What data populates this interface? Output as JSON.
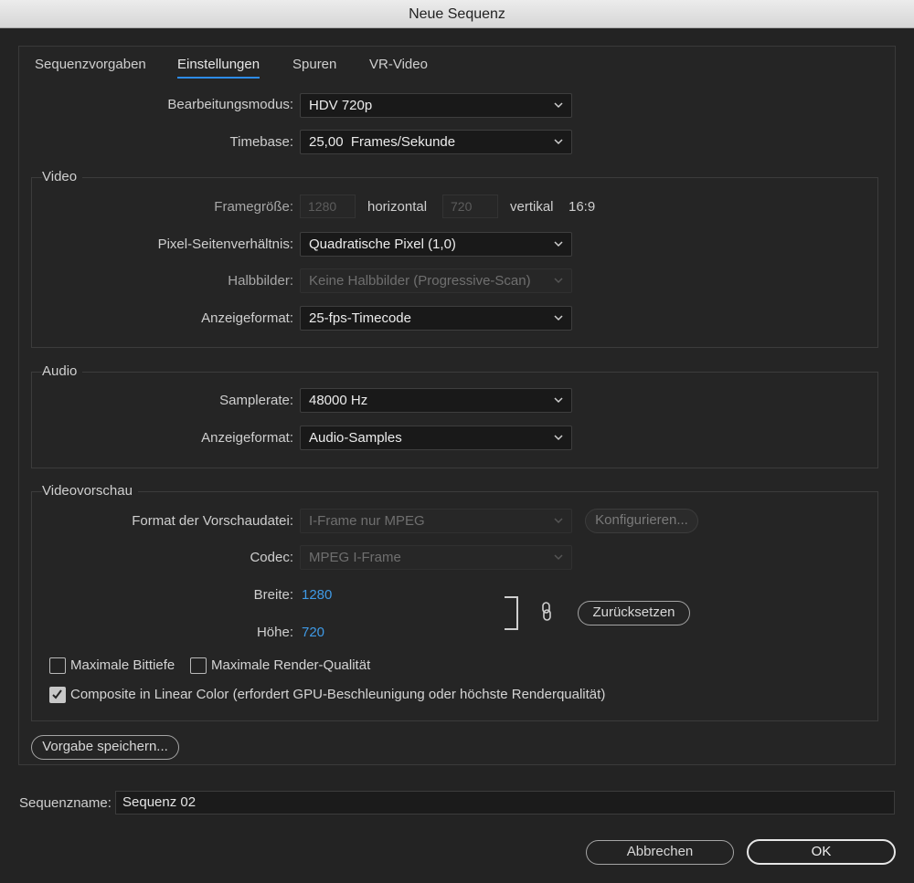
{
  "window": {
    "title": "Neue Sequenz"
  },
  "tabs": [
    {
      "label": "Sequenzvorgaben"
    },
    {
      "label": "Einstellungen",
      "active": true
    },
    {
      "label": "Spuren"
    },
    {
      "label": "VR-Video"
    }
  ],
  "general": {
    "edit_mode_label": "Bearbeitungsmodus:",
    "edit_mode_value": "HDV 720p",
    "timebase_label": "Timebase:",
    "timebase_value": "25,00  Frames/Sekunde"
  },
  "video": {
    "title": "Video",
    "frame_size_label": "Framegröße:",
    "frame_width": "1280",
    "horizontal_label": "horizontal",
    "frame_height": "720",
    "vertical_label": "vertikal",
    "aspect": "16:9",
    "pixel_aspect_label": "Pixel-Seitenverhältnis:",
    "pixel_aspect_value": "Quadratische Pixel (1,0)",
    "fields_label": "Halbbilder:",
    "fields_value": "Keine Halbbilder (Progressive-Scan)",
    "display_format_label": "Anzeigeformat:",
    "display_format_value": "25-fps-Timecode"
  },
  "audio": {
    "title": "Audio",
    "sample_rate_label": "Samplerate:",
    "sample_rate_value": "48000 Hz",
    "display_format_label": "Anzeigeformat:",
    "display_format_value": "Audio-Samples"
  },
  "preview": {
    "title": "Videovorschau",
    "file_format_label": "Format der Vorschaudatei:",
    "file_format_value": "I-Frame nur MPEG",
    "configure_label": "Konfigurieren...",
    "codec_label": "Codec:",
    "codec_value": "MPEG I-Frame",
    "width_label": "Breite:",
    "width_value": "1280",
    "height_label": "Höhe:",
    "height_value": "720",
    "reset_label": "Zurücksetzen",
    "max_bit_depth_label": "Maximale Bittiefe",
    "max_bit_depth_checked": false,
    "max_render_quality_label": "Maximale Render-Qualität",
    "max_render_quality_checked": false,
    "composite_linear_label": "Composite in Linear Color (erfordert GPU-Beschleunigung oder höchste Renderqualität)",
    "composite_linear_checked": true
  },
  "save_preset_label": "Vorgabe speichern...",
  "sequence_name_label": "Sequenzname:",
  "sequence_name_value": "Sequenz 02",
  "cancel_label": "Abbrechen",
  "ok_label": "OK"
}
